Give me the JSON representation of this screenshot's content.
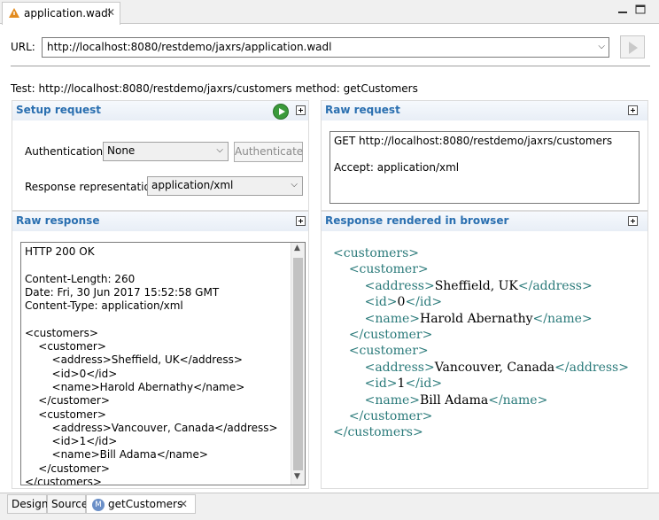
{
  "editor_tab": {
    "title": "application.wadl",
    "close": "✕"
  },
  "url": {
    "label": "URL:",
    "value": "http://localhost:8080/restdemo/jaxrs/application.wadl"
  },
  "test_line": "Test: http://localhost:8080/restdemo/jaxrs/customers method: getCustomers",
  "setup": {
    "title": "Setup request",
    "auth_label": "Authentication:",
    "auth_value": "None",
    "auth_button": "Authenticate",
    "repr_label": "Response representation:",
    "repr_value": "application/xml"
  },
  "raw_request": {
    "title": "Raw request",
    "lines": [
      "GET http://localhost:8080/restdemo/jaxrs/customers",
      "",
      "Accept: application/xml"
    ]
  },
  "raw_response": {
    "title": "Raw response",
    "lines": [
      "HTTP 200 OK",
      "",
      "Content-Length: 260",
      "Date: Fri, 30 Jun 2017 15:52:58 GMT",
      "Content-Type: application/xml",
      "",
      "<customers>",
      "    <customer>",
      "        <address>Sheffield, UK</address>",
      "        <id>0</id>",
      "        <name>Harold Abernathy</name>",
      "    </customer>",
      "    <customer>",
      "        <address>Vancouver, Canada</address>",
      "        <id>1</id>",
      "        <name>Bill Adama</name>",
      "    </customer>",
      "</customers>"
    ]
  },
  "rendered": {
    "title": "Response rendered in browser",
    "customers_open": "<customers>",
    "customers_close": "</customers>",
    "customer_open": "<customer>",
    "customer_close": "</customer>",
    "records": [
      {
        "address": "Sheffield, UK",
        "id": "0",
        "name": "Harold Abernathy"
      },
      {
        "address": "Vancouver, Canada",
        "id": "1",
        "name": "Bill Adama"
      }
    ]
  },
  "bottom_tabs": {
    "design": "Design",
    "source": "Source",
    "method": "getCustomers",
    "method_icon": "M",
    "close": "✕"
  },
  "icons": {
    "wadl": "warning-triangle-icon",
    "run": "play-icon",
    "expand": "plus-icon"
  }
}
